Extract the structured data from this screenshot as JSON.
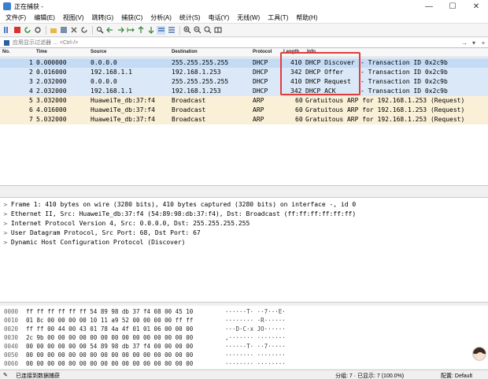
{
  "window": {
    "title": "正在捕获 -"
  },
  "menu": [
    "文件(F)",
    "编辑(E)",
    "视图(V)",
    "跳转(G)",
    "捕获(C)",
    "分析(A)",
    "统计(S)",
    "电话(Y)",
    "无线(W)",
    "工具(T)",
    "帮助(H)"
  ],
  "filter": {
    "placeholder": "应用显示过滤器 … <Ctrl-/>"
  },
  "packet_list": {
    "columns": [
      "No.",
      "Time",
      "Source",
      "Destination",
      "Protocol",
      "Length",
      "Info"
    ],
    "rows": [
      {
        "no": "1",
        "time": "0.000000",
        "src": "0.0.0.0",
        "dst": "255.255.255.255",
        "proto": "DHCP",
        "len": "410",
        "info_type": "DHCP Discover",
        "info_rest": "- Transaction ID 0x2c9b"
      },
      {
        "no": "2",
        "time": "0.016000",
        "src": "192.168.1.1",
        "dst": "192.168.1.253",
        "proto": "DHCP",
        "len": "342",
        "info_type": "DHCP Offer",
        "info_rest": "- Transaction ID 0x2c9b"
      },
      {
        "no": "3",
        "time": "2.032000",
        "src": "0.0.0.0",
        "dst": "255.255.255.255",
        "proto": "DHCP",
        "len": "410",
        "info_type": "DHCP Request",
        "info_rest": "- Transaction ID 0x2c9b"
      },
      {
        "no": "4",
        "time": "2.032000",
        "src": "192.168.1.1",
        "dst": "192.168.1.253",
        "proto": "DHCP",
        "len": "342",
        "info_type": "DHCP ACK",
        "info_rest": "- Transaction ID 0x2c9b"
      },
      {
        "no": "5",
        "time": "3.032000",
        "src": "HuaweiTe_db:37:f4",
        "dst": "Broadcast",
        "proto": "ARP",
        "len": "60",
        "info_type": "Gratuitous ARP for 192.168.1.253 (Request)",
        "info_rest": ""
      },
      {
        "no": "6",
        "time": "4.016000",
        "src": "HuaweiTe_db:37:f4",
        "dst": "Broadcast",
        "proto": "ARP",
        "len": "60",
        "info_type": "Gratuitous ARP for 192.168.1.253 (Request)",
        "info_rest": ""
      },
      {
        "no": "7",
        "time": "5.032000",
        "src": "HuaweiTe_db:37:f4",
        "dst": "Broadcast",
        "proto": "ARP",
        "len": "60",
        "info_type": "Gratuitous ARP for 192.168.1.253 (Request)",
        "info_rest": ""
      }
    ]
  },
  "details": [
    "Frame 1: 410 bytes on wire (3280 bits), 410 bytes captured (3280 bits) on interface -, id 0",
    "Ethernet II, Src: HuaweiTe_db:37:f4 (54:89:98:db:37:f4), Dst: Broadcast (ff:ff:ff:ff:ff:ff)",
    "Internet Protocol Version 4, Src: 0.0.0.0, Dst: 255.255.255.255",
    "User Datagram Protocol, Src Port: 68, Dst Port: 67",
    "Dynamic Host Configuration Protocol (Discover)"
  ],
  "hex": [
    {
      "off": "0000",
      "bytes": "ff ff ff ff ff ff 54 89  98 db 37 f4 08 00 45 10",
      "ascii": "······T· ··7···E·"
    },
    {
      "off": "0010",
      "bytes": "01 8c 00 00 00 00 10 11  a9 52 00 00 00 00 ff ff",
      "ascii": "········ ·R······"
    },
    {
      "off": "0020",
      "bytes": "ff ff 00 44 00 43 01 78  4a 4f 01 01 06 00 00 00",
      "ascii": "···D·C·x JO······"
    },
    {
      "off": "0030",
      "bytes": "2c 9b 00 00 00 00 00 00  00 00 00 00 00 00 00 00",
      "ascii": ",······· ········"
    },
    {
      "off": "0040",
      "bytes": "00 00 00 00 00 00 54 89  98 db 37 f4 00 00 00 00",
      "ascii": "······T· ··7·····"
    },
    {
      "off": "0050",
      "bytes": "00 00 00 00 00 00 00 00  00 00 00 00 00 00 00 00",
      "ascii": "········ ········"
    },
    {
      "off": "0060",
      "bytes": "00 00 00 00 00 00 00 00  00 00 00 00 00 00 00 00",
      "ascii": "········ ········"
    }
  ],
  "status": {
    "left": "已连接到数据捕获",
    "packets": "分组: 7 · 已显示: 7 (100.0%)",
    "profile": "配置: Default"
  }
}
